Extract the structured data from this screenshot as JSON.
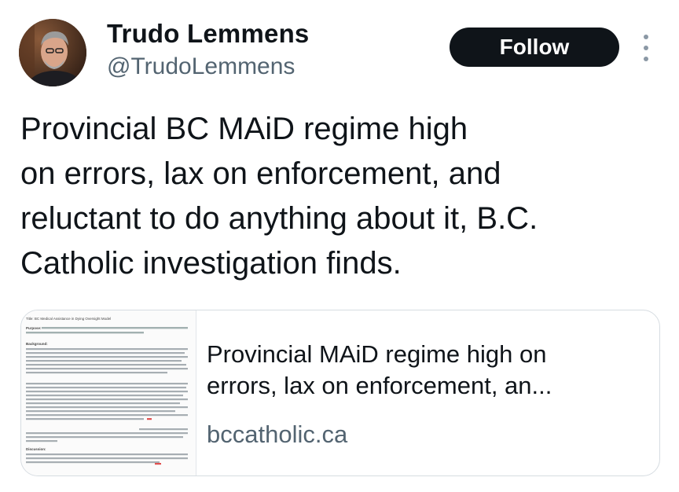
{
  "author": {
    "name": "Trudo Lemmens",
    "handle": "@TrudoLemmens"
  },
  "actions": {
    "follow_label": "Follow",
    "more_icon": "vertical-ellipsis-icon"
  },
  "tweet": {
    "lines": [
      "Provincial BC MAiD regime high",
      "on errors, lax on enforcement, and",
      "reluctant to do anything about it, B.C.",
      "Catholic investigation finds."
    ]
  },
  "link_card": {
    "title_lines": [
      "Provincial MAiD regime high on",
      "errors, lax on enforcement, an..."
    ],
    "domain": "bccatholic.ca",
    "thumbnail": {
      "title": "Title: BC Medical Assistance in Dying Oversight Model",
      "purpose": "Purpose: To seek direction on the oversight model for Medical Assistance in Dying (MAiD) in BC as an initial step toward developing a provincial MAiD Oversight Policy",
      "background_heading": "Background:",
      "discussion_heading": "Discussion:"
    }
  },
  "colors": {
    "follow_bg": "#0f1419",
    "secondary_text": "#536471",
    "border": "#d6dce1"
  }
}
